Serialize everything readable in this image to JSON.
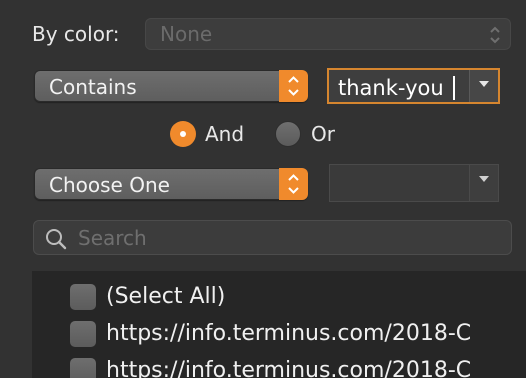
{
  "by_color": {
    "label": "By color:",
    "value": "None"
  },
  "condition": {
    "value": "Contains"
  },
  "text_filter": {
    "value": "thank-you"
  },
  "logic": {
    "and_label": "And",
    "or_label": "Or",
    "selected": "And"
  },
  "second_condition": {
    "value": "Choose One"
  },
  "search": {
    "placeholder": "Search"
  },
  "list": {
    "items": [
      {
        "label": "(Select All)",
        "checked": false
      },
      {
        "label": "https://info.terminus.com/2018-C",
        "checked": false
      },
      {
        "label": "https://info.terminus.com/2018-C",
        "checked": false
      }
    ]
  },
  "colors": {
    "accent": "#f08a2c",
    "background": "#323232",
    "list_background": "#262626"
  }
}
